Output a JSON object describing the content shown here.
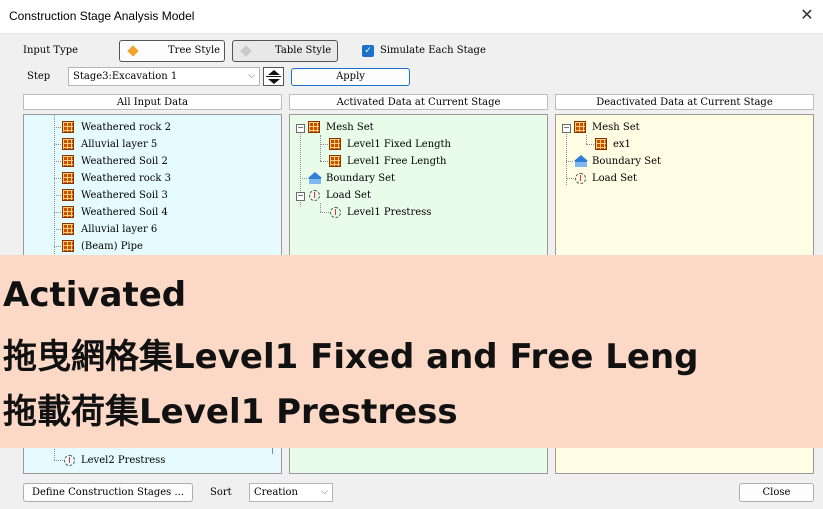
{
  "window": {
    "title": "Construction Stage Analysis Model",
    "close_glyph": "✕"
  },
  "toolbar": {
    "input_type_label": "Input Type",
    "tree_style_label": "Tree Style",
    "table_style_label": "Table Style",
    "simulate_label": "Simulate Each Stage",
    "simulate_checked": true,
    "step_label": "Step",
    "step_value": "Stage3:Excavation 1",
    "apply_label": "Apply"
  },
  "panels": {
    "all_input": {
      "header": "All Input Data",
      "items": [
        {
          "label": "Weathered rock 2",
          "icon": "mesh-icon"
        },
        {
          "label": "Alluvial layer 5",
          "icon": "mesh-icon"
        },
        {
          "label": "Weathered Soil 2",
          "icon": "mesh-icon"
        },
        {
          "label": "Weathered rock 3",
          "icon": "mesh-icon"
        },
        {
          "label": "Weathered Soil 3",
          "icon": "mesh-icon"
        },
        {
          "label": "Weathered Soil 4",
          "icon": "mesh-icon"
        },
        {
          "label": "Alluvial layer 6",
          "icon": "mesh-icon"
        },
        {
          "label": "(Beam) Pipe",
          "icon": "mesh-icon"
        },
        {
          "label": "Level2 Prestress",
          "icon": "load-icon"
        }
      ],
      "bg_color": "#e6fbff"
    },
    "activated": {
      "header": "Activated Data at Current Stage",
      "items": [
        {
          "label": "Mesh Set",
          "icon": "mesh-icon"
        },
        {
          "label": "Level1 Fixed Length",
          "icon": "mesh-icon"
        },
        {
          "label": "Level1 Free Length",
          "icon": "mesh-icon"
        },
        {
          "label": "Boundary Set",
          "icon": "boundary-icon"
        },
        {
          "label": "Load Set",
          "icon": "load-icon"
        },
        {
          "label": "Level1 Prestress",
          "icon": "load-icon"
        }
      ],
      "bg_color": "#e9fce9"
    },
    "deactivated": {
      "header": "Deactivated Data at Current Stage",
      "items": [
        {
          "label": "Mesh Set",
          "icon": "mesh-icon"
        },
        {
          "label": "ex1",
          "icon": "mesh-icon"
        },
        {
          "label": "Boundary Set",
          "icon": "boundary-icon"
        },
        {
          "label": "Load Set",
          "icon": "load-icon"
        }
      ],
      "bg_color": "#fffde3"
    }
  },
  "footer": {
    "define_label": "Define Construction Stages ...",
    "sort_label": "Sort",
    "sort_value": "Creation",
    "close_label": "Close"
  },
  "overlay": {
    "line1": "Activated",
    "line2": "拖曳網格集Level1 Fixed and Free Leng",
    "line3": "拖載荷集Level1 Prestress",
    "bg_color": "#fbd9c6"
  },
  "colors": {
    "accent": "#1a73c8",
    "tree_style_diamond": "#f3a32a",
    "table_style_diamond": "#c8c8c8"
  }
}
